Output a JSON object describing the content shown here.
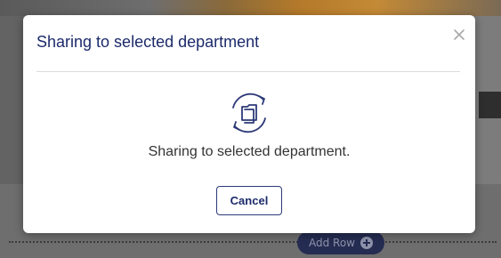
{
  "modal": {
    "title": "Sharing to selected department",
    "message": "Sharing to selected department.",
    "cancel_label": "Cancel",
    "close_icon": "close-icon",
    "status_icon": "folder-sync-icon"
  },
  "background": {
    "add_row_label": "Add Row",
    "add_row_icon": "plus-circle-icon"
  },
  "colors": {
    "title": "#1c2a6b",
    "button_border": "#2d3a78",
    "icon": "#2d3a78",
    "add_row_bg": "#252c52"
  }
}
